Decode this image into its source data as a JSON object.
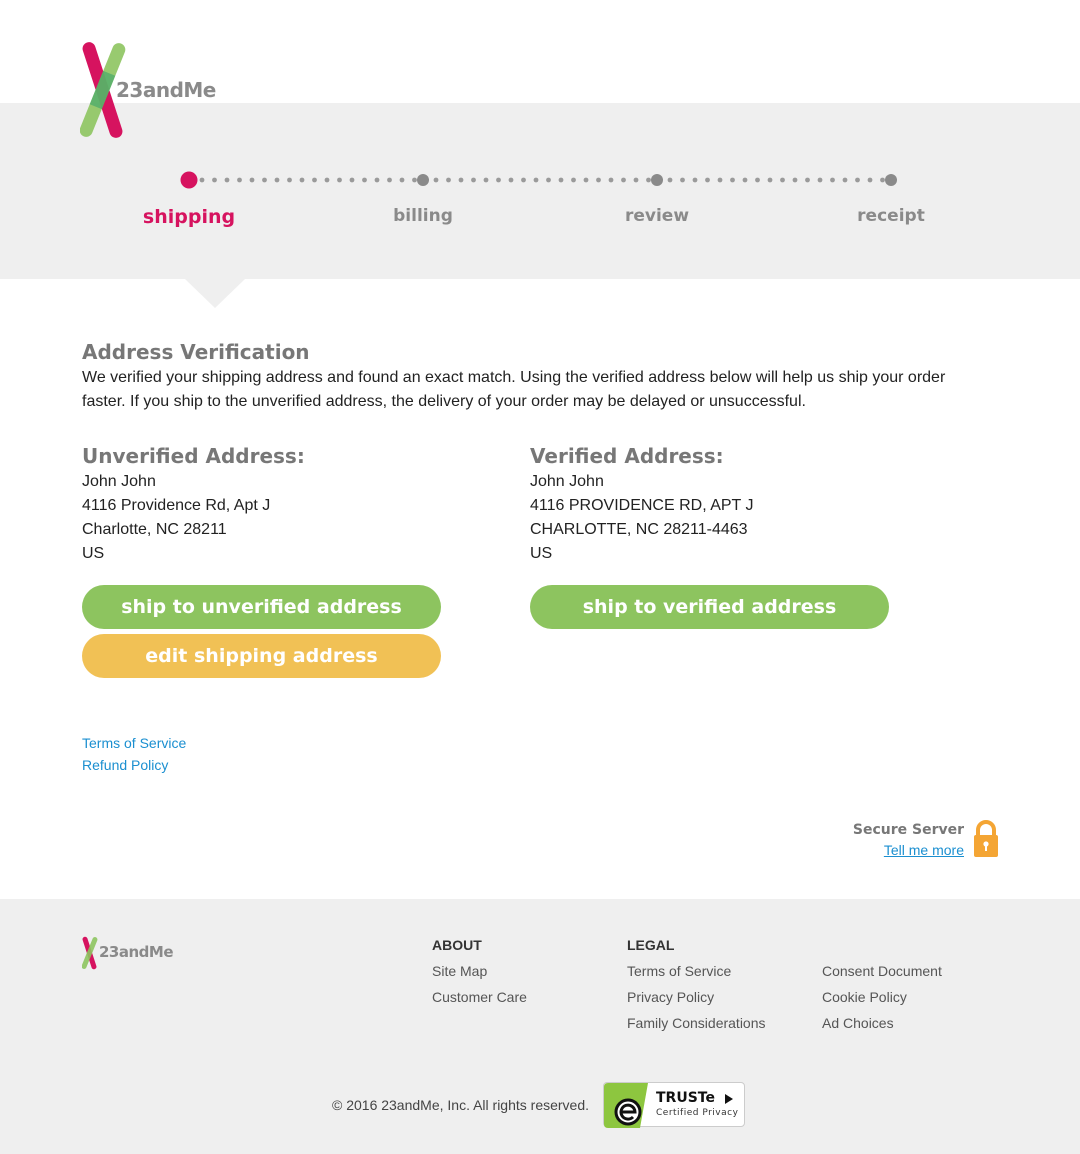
{
  "brand": {
    "name": "23andMe",
    "colors": {
      "magenta": "#d6135f",
      "green": "#8dc45f",
      "yellow": "#f1c155",
      "link": "#1b8fd0"
    }
  },
  "progress": {
    "steps": [
      {
        "label": "shipping",
        "active": true
      },
      {
        "label": "billing",
        "active": false
      },
      {
        "label": "review",
        "active": false
      },
      {
        "label": "receipt",
        "active": false
      }
    ]
  },
  "verification": {
    "title": "Address Verification",
    "intro": "We verified your shipping address and found an exact match. Using the verified address below will help us ship your order faster. If you ship to the unverified address, the delivery of your order may be delayed or unsuccessful."
  },
  "unverified": {
    "heading": "Unverified Address:",
    "lines": [
      "John John",
      "4116 Providence Rd, Apt J",
      "Charlotte, NC 28211",
      "US"
    ],
    "ship_button": "ship to unverified address",
    "edit_button": "edit shipping address"
  },
  "verified": {
    "heading": "Verified Address:",
    "lines": [
      "John John",
      "4116 PROVIDENCE RD, APT J",
      "CHARLOTTE, NC 28211-4463",
      "US"
    ],
    "ship_button": "ship to verified address"
  },
  "links": {
    "terms": "Terms of Service",
    "refund": "Refund Policy"
  },
  "secure": {
    "label": "Secure Server",
    "link": "Tell me more",
    "icon": "lock-icon"
  },
  "footer": {
    "about": {
      "heading": "ABOUT",
      "items": [
        "Site Map",
        "Customer Care"
      ]
    },
    "legal": {
      "heading": "LEGAL",
      "items": [
        "Terms of Service",
        "Privacy Policy",
        "Family Considerations"
      ]
    },
    "legal2": {
      "items": [
        "Consent Document",
        "Cookie Policy",
        "Ad Choices"
      ]
    },
    "copyright": "© 2016 23andMe, Inc. All rights reserved.",
    "truste": {
      "title": "TRUSTe",
      "subtitle": "Certified Privacy"
    }
  }
}
